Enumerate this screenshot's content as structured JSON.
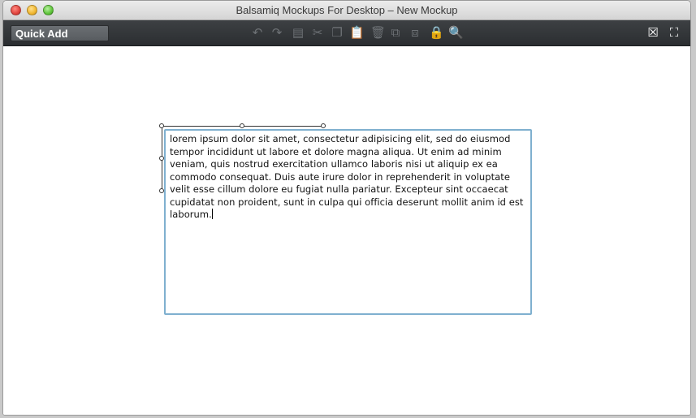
{
  "window": {
    "title": "Balsamiq Mockups For Desktop – New Mockup"
  },
  "toolbar": {
    "quick_add_label": "Quick Add",
    "tools": [
      {
        "name": "undo-icon",
        "glyph": "↶",
        "active": false
      },
      {
        "name": "redo-icon",
        "glyph": "↷",
        "active": false
      },
      {
        "name": "duplicate-icon",
        "glyph": "▤",
        "active": false
      },
      {
        "name": "cut-icon",
        "glyph": "✂",
        "active": false
      },
      {
        "name": "copy-icon",
        "glyph": "❐",
        "active": false
      },
      {
        "name": "paste-icon",
        "glyph": "📋",
        "active": true
      },
      {
        "name": "delete-icon",
        "glyph": "🗑",
        "active": false
      },
      {
        "name": "group-icon",
        "glyph": "⧉",
        "active": false
      },
      {
        "name": "ungroup-icon",
        "glyph": "⧈",
        "active": false
      },
      {
        "name": "lock-icon",
        "glyph": "🔒",
        "active": false
      },
      {
        "name": "search-icon",
        "glyph": "🔍",
        "active": true
      }
    ],
    "right_tools": [
      {
        "name": "close-mockup-icon",
        "glyph": "☒"
      },
      {
        "name": "fullscreen-icon",
        "glyph": "⛶"
      }
    ]
  },
  "canvas": {
    "textarea_text": "lorem ipsum dolor sit amet, consectetur adipisicing elit, sed do eiusmod tempor incididunt ut labore et dolore magna aliqua. Ut enim ad minim veniam, quis nostrud exercitation ullamco laboris nisi ut aliquip ex ea commodo consequat. Duis aute irure dolor in reprehenderit in voluptate velit esse cillum dolore eu fugiat nulla pariatur. Excepteur sint occaecat cupidatat non proident, sunt in culpa qui officia deserunt mollit anim id est laborum."
  },
  "colors": {
    "toolbar_bg": "#2f3235",
    "textarea_border": "#7fb0cf"
  }
}
